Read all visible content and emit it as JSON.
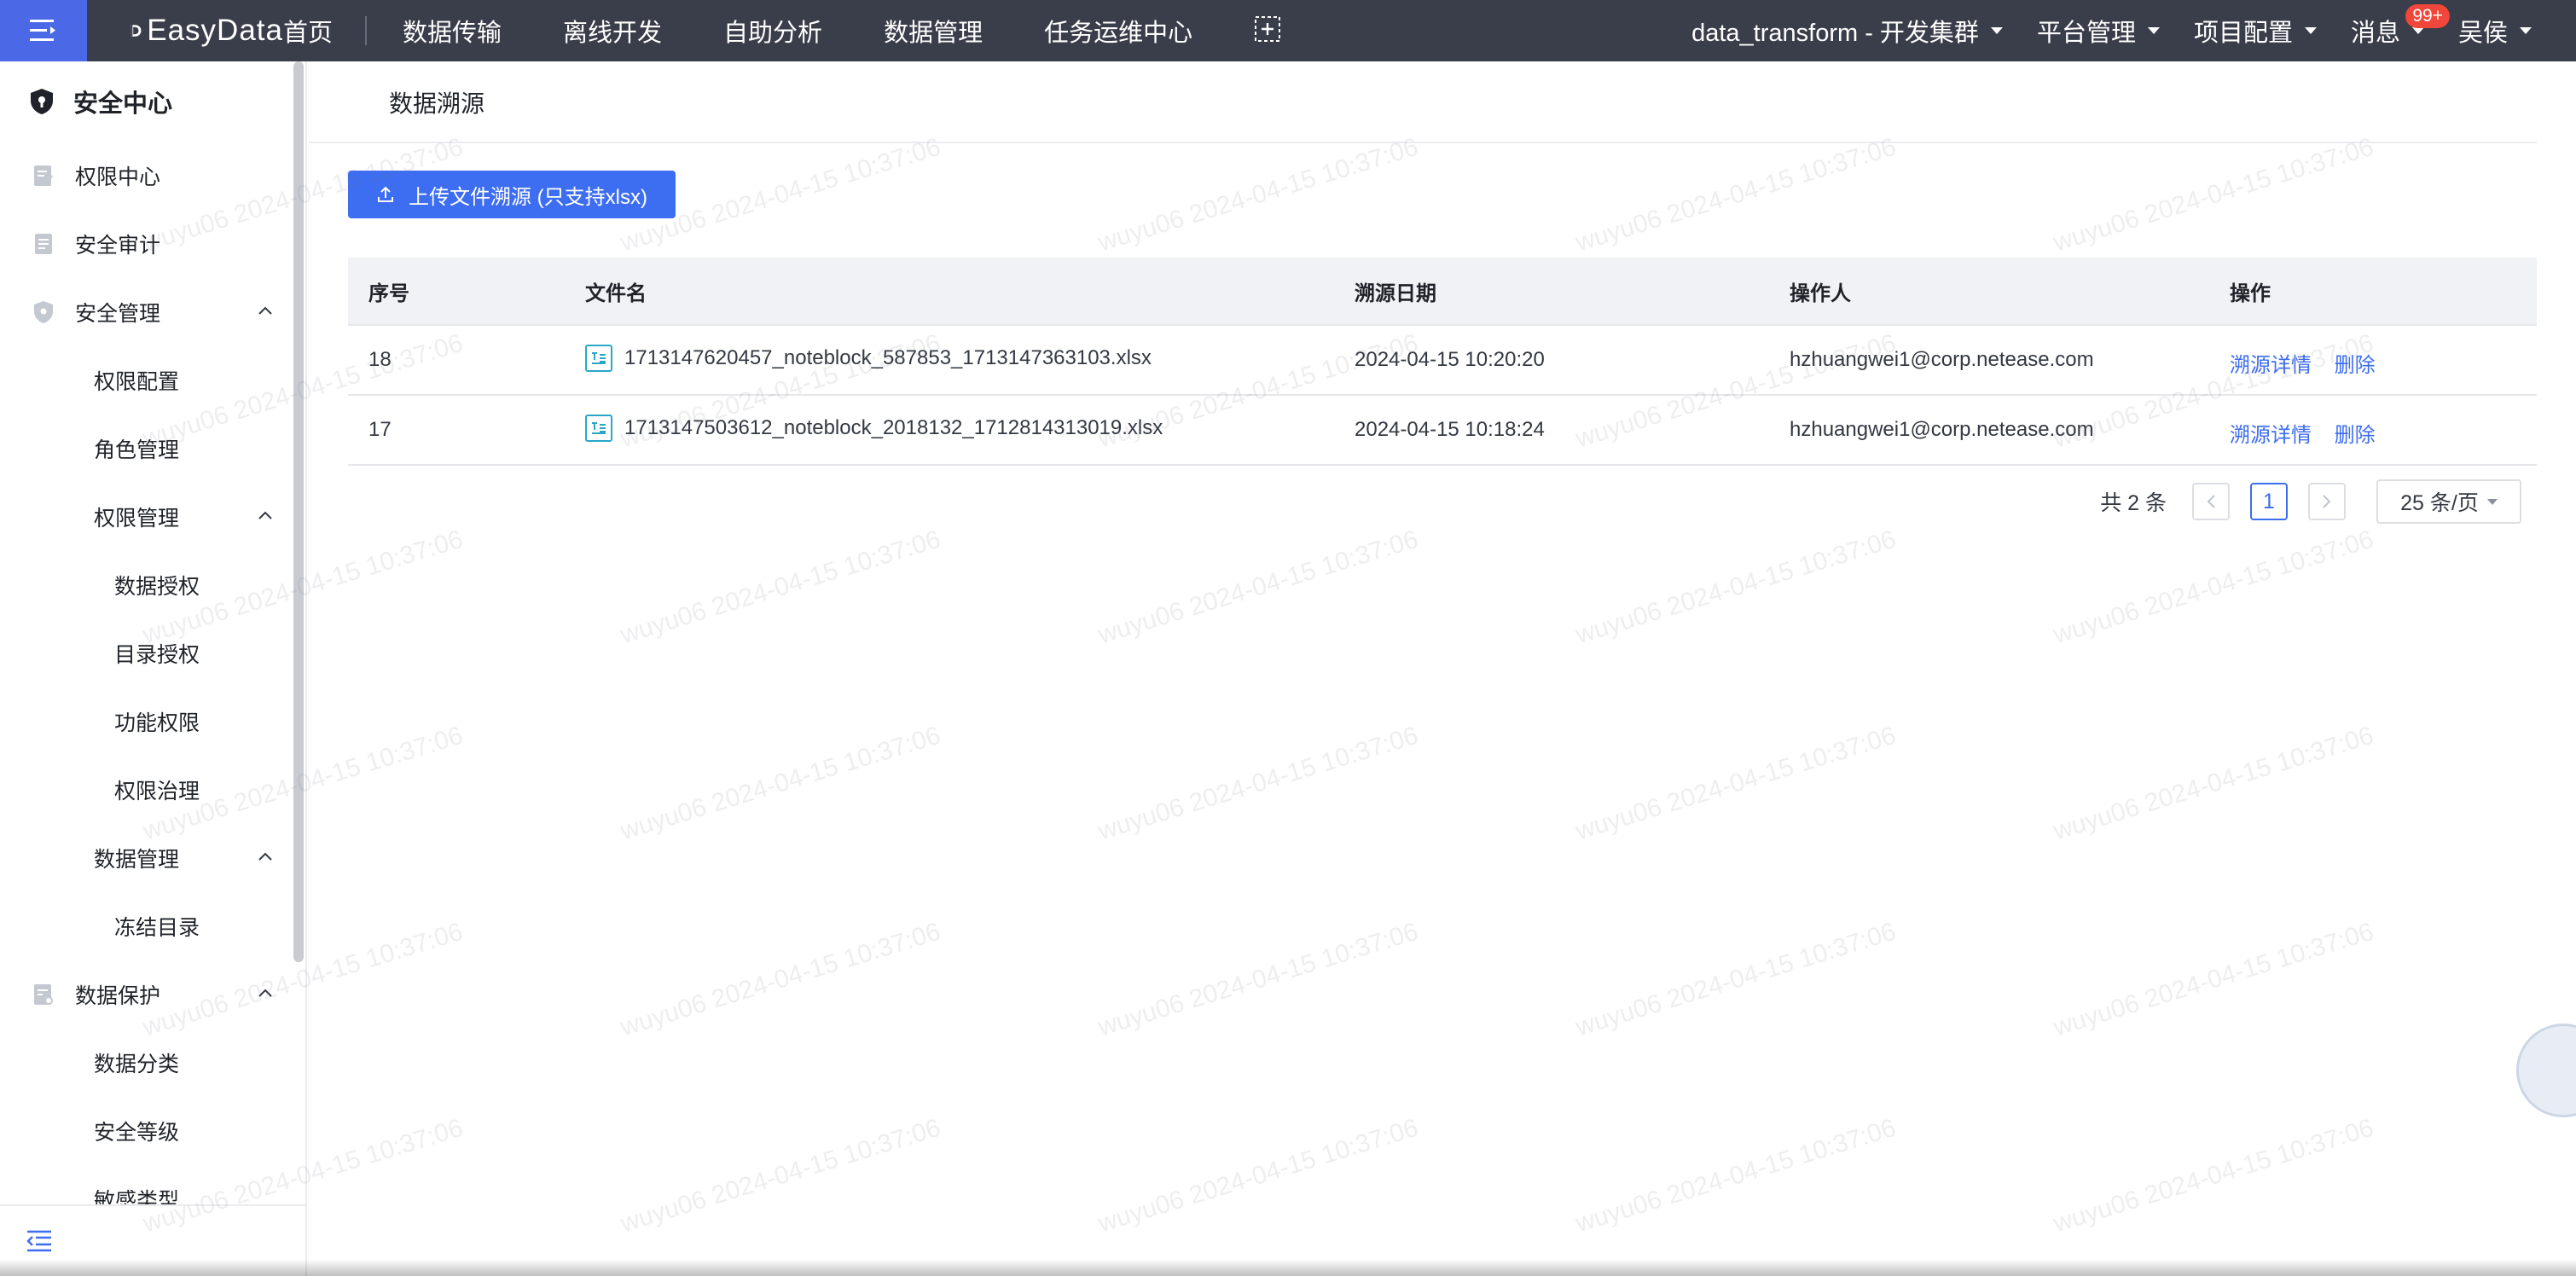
{
  "topbar": {
    "brand": "EasyData",
    "nav": [
      "首页",
      "数据传输",
      "离线开发",
      "自助分析",
      "数据管理",
      "任务运维中心"
    ],
    "cluster": "data_transform - 开发集群",
    "platform": "平台管理",
    "project": "项目配置",
    "messages": "消息",
    "badge": "99+",
    "user": "吴侯"
  },
  "sidebar": {
    "title": "安全中心",
    "items": [
      {
        "label": "权限中心"
      },
      {
        "label": "安全审计"
      },
      {
        "label": "安全管理"
      },
      {
        "label": "权限配置"
      },
      {
        "label": "角色管理"
      },
      {
        "label": "权限管理"
      },
      {
        "label": "数据授权"
      },
      {
        "label": "目录授权"
      },
      {
        "label": "功能权限"
      },
      {
        "label": "权限治理"
      },
      {
        "label": "数据管理"
      },
      {
        "label": "冻结目录"
      },
      {
        "label": "数据保护"
      },
      {
        "label": "数据分类"
      },
      {
        "label": "安全等级"
      },
      {
        "label": "敏感类型"
      }
    ]
  },
  "page": {
    "title": "数据溯源",
    "upload_label": "上传文件溯源 (只支持xlsx)"
  },
  "table": {
    "columns": [
      "序号",
      "文件名",
      "溯源日期",
      "操作人",
      "操作"
    ],
    "rows": [
      {
        "id": "18",
        "file": "1713147620457_noteblock_587853_1713147363103.xlsx",
        "date": "2024-04-15 10:20:20",
        "operator": "hzhuangwei1@corp.netease.com",
        "detail": "溯源详情",
        "delete": "删除"
      },
      {
        "id": "17",
        "file": "1713147503612_noteblock_2018132_1712814313019.xlsx",
        "date": "2024-04-15 10:18:24",
        "operator": "hzhuangwei1@corp.netease.com",
        "detail": "溯源详情",
        "delete": "删除"
      }
    ]
  },
  "pagination": {
    "total": "共 2 条",
    "current": "1",
    "page_size": "25 条/页"
  },
  "watermark": "wuyu06 2024-04-15 10:37:06",
  "colors": {
    "topbar": "#3a3d4a",
    "accent": "#3d6df0",
    "menu_toggle": "#4b68e6",
    "badge": "#f0473a"
  }
}
